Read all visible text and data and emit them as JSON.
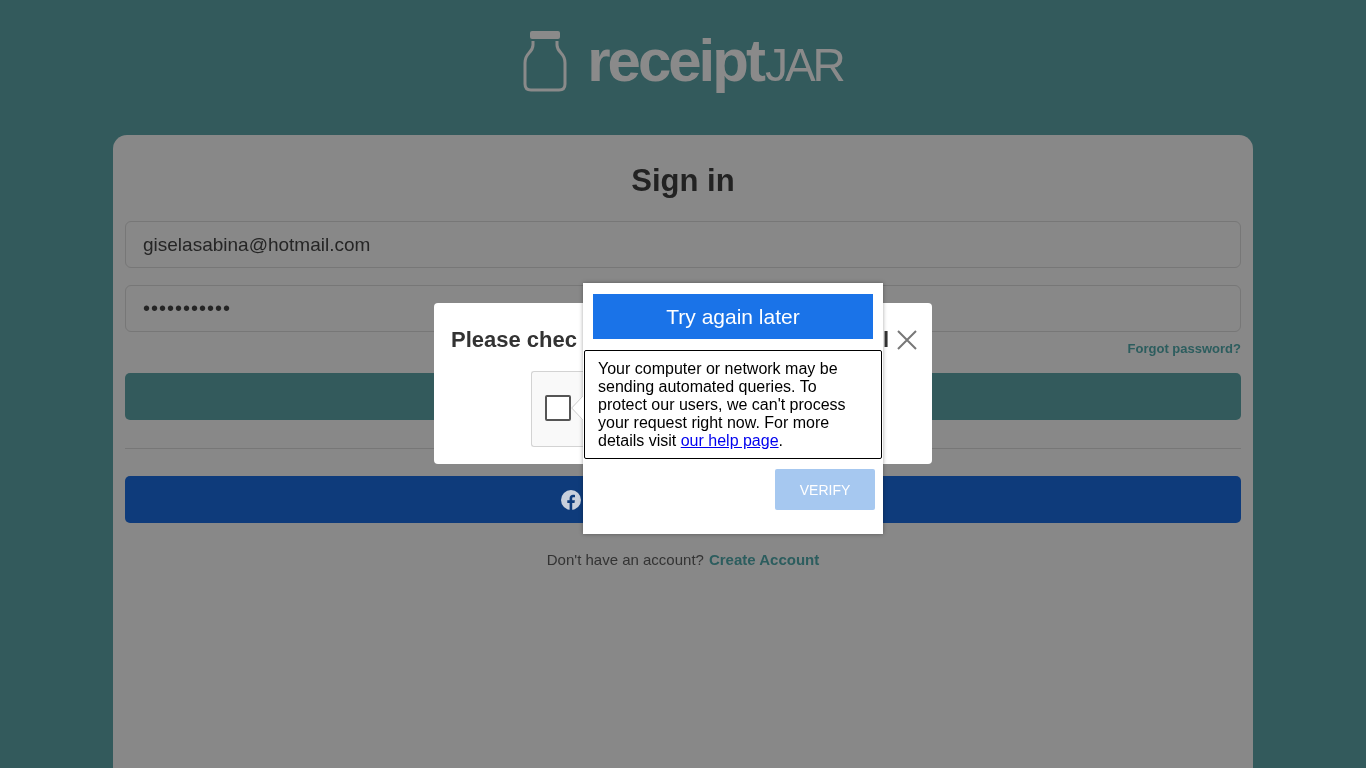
{
  "logo": {
    "text_bold": "receipt",
    "text_light": "JAR"
  },
  "sign_in": {
    "title": "Sign in",
    "email": {
      "value": "giselasabina@hotmail.com"
    },
    "password": {
      "value": "•••••••••••"
    },
    "forgot_password": "Forgot password?"
  },
  "signup_prompt": {
    "text": "Don't have an account?",
    "link": "Create Account"
  },
  "captcha_modal": {
    "title": "Please chec",
    "title_end": "l",
    "checkbox": {
      "checked": false
    }
  },
  "captcha_popup": {
    "header": "Try again later",
    "message": "Your computer or network may be sending automated queries. To protect our users, we can't process your request right now. For more details visit",
    "link": "our help page",
    "message_end": ".",
    "verify_button": {
      "label": "VERIFY",
      "disabled": true
    }
  }
}
